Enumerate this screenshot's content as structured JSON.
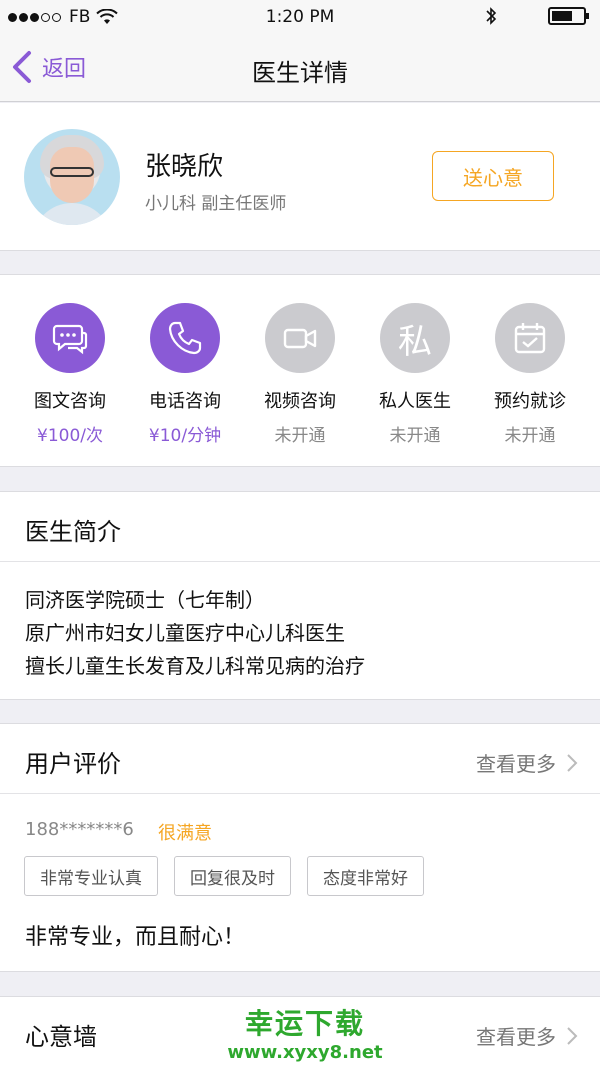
{
  "status_bar": {
    "carrier": "FB",
    "time": "1:20 PM"
  },
  "nav": {
    "back_label": "返回",
    "title": "医生详情"
  },
  "doctor": {
    "name": "张晓欣",
    "department_title": "小儿科  副主任医师",
    "gift_button": "送心意"
  },
  "services": [
    {
      "label": "图文咨询",
      "price": "¥100/次",
      "icon": "chat-bubbles-icon",
      "state": "active"
    },
    {
      "label": "电话咨询",
      "price": "¥10/分钟",
      "icon": "phone-icon",
      "state": "active"
    },
    {
      "label": "视频咨询",
      "price": "未开通",
      "icon": "video-camera-icon",
      "state": "inactive"
    },
    {
      "label": "私人医生",
      "price": "未开通",
      "icon": "private-doctor-icon",
      "glyph": "私",
      "state": "inactive"
    },
    {
      "label": "预约就诊",
      "price": "未开通",
      "icon": "calendar-check-icon",
      "state": "inactive"
    }
  ],
  "intro": {
    "title": "医生简介",
    "lines": [
      "同济医学院硕士（七年制）",
      "原广州市妇女儿童医疗中心儿科医生",
      "擅长儿童生长发育及儿科常见病的治疗"
    ]
  },
  "reviews": {
    "title": "用户评价",
    "more_label": "查看更多",
    "items": [
      {
        "user": "188*******6",
        "rating": "很满意",
        "tags": [
          "非常专业认真",
          "回复很及时",
          "态度非常好"
        ],
        "text": "非常专业，而且耐心！"
      }
    ]
  },
  "wall": {
    "title": "心意墙",
    "more_label": "查看更多"
  },
  "watermark": {
    "main": "幸运下载",
    "sub": "www.xyxy8.net"
  },
  "colors": {
    "accent": "#8a5ad6",
    "gift": "#f5a623",
    "inactive": "#cbcbcf"
  }
}
